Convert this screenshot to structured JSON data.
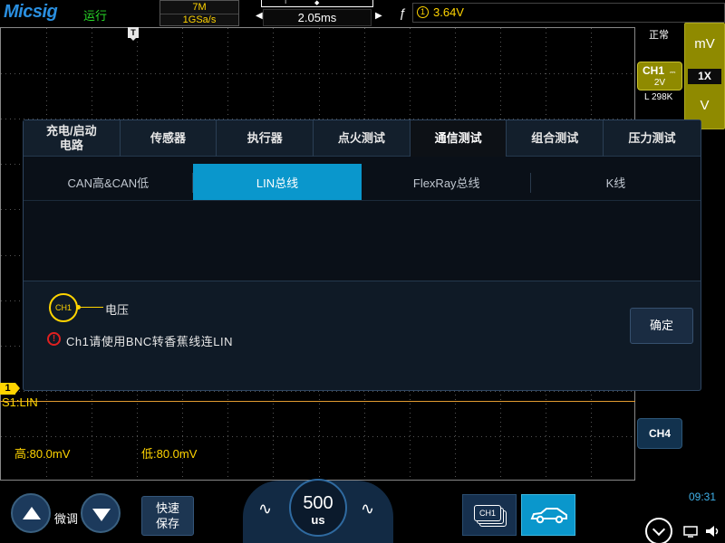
{
  "topbar": {
    "brand": "Micsig",
    "run_state": "运行",
    "memory_depth": "7M",
    "sample_rate": "1GSa/s",
    "timebase": "2.05ms",
    "trigger_source_number": "1",
    "trigger_level": "3.64V",
    "ruler_marker_t": "T"
  },
  "grid": {
    "trigger_marker": "T",
    "channel_marker": "1",
    "trace_label": "S1:LIN",
    "high_level": "高:80.0mV",
    "low_level": "低:80.0mV",
    "trace_color": "#e09a30"
  },
  "right_panel": {
    "status": "正常",
    "unit_top": "mV",
    "probe_factor": "1X",
    "unit_bottom": "V",
    "ch1_label": "CH1",
    "ch1_scale": "2V",
    "ch1_coupling": "⎓",
    "record_length": "L 298K",
    "ch4_label": "CH4",
    "clock": "09:31"
  },
  "dialog": {
    "main_tabs": [
      {
        "label": "充电/启动\n电路",
        "active": false
      },
      {
        "label": "传感器",
        "active": false
      },
      {
        "label": "执行器",
        "active": false
      },
      {
        "label": "点火测试",
        "active": false
      },
      {
        "label": "通信测试",
        "active": true
      },
      {
        "label": "组合测试",
        "active": false
      },
      {
        "label": "压力测试",
        "active": false
      }
    ],
    "sub_tabs": [
      {
        "label": "CAN高&CAN低",
        "active": false
      },
      {
        "label": "LIN总线",
        "active": true
      },
      {
        "label": "FlexRay总线",
        "active": false
      },
      {
        "label": "K线",
        "active": false
      }
    ],
    "probe_channel": "CH1",
    "probe_label": "电压",
    "warning_text": "Ch1请使用BNC转香蕉线连LIN",
    "confirm_label": "确定",
    "accent_color": "#0a97cc"
  },
  "bottombar": {
    "fine_label": "微调",
    "save_label_line1": "快速",
    "save_label_line2": "保存",
    "knob_value": "500",
    "knob_unit": "us",
    "channel_stack_label": "CH1",
    "icons": [
      "up-arrow-icon",
      "down-arrow-icon",
      "sine-wave-icon",
      "car-icon",
      "chevron-down-icon",
      "monitor-icon",
      "speaker-icon"
    ]
  }
}
